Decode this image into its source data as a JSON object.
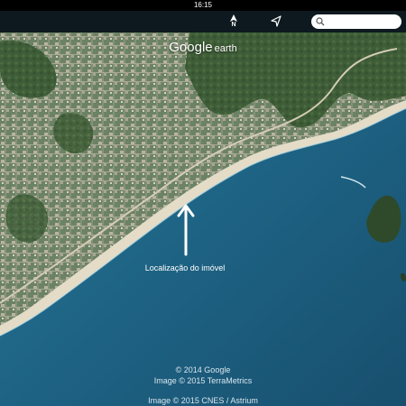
{
  "status_bar": {
    "time": "16:15"
  },
  "toolbar": {
    "compass_icon": "compass-north-icon",
    "compass_label": "N",
    "locate_icon": "location-arrow-icon",
    "search_icon": "search-icon",
    "search_value": "",
    "search_placeholder": ""
  },
  "map": {
    "brand_google": "Google",
    "brand_earth": "earth",
    "annotation_label": "Localização do imóvel",
    "attribution": [
      "© 2014 Google",
      "Image © 2015 TerraMetrics",
      "Image © 2015 CNES / Astrium"
    ],
    "colors": {
      "ocean": "#1d5f7e",
      "land": "#5e7a52",
      "beach": "#e8dfc8",
      "arrow": "#ffffff"
    }
  }
}
